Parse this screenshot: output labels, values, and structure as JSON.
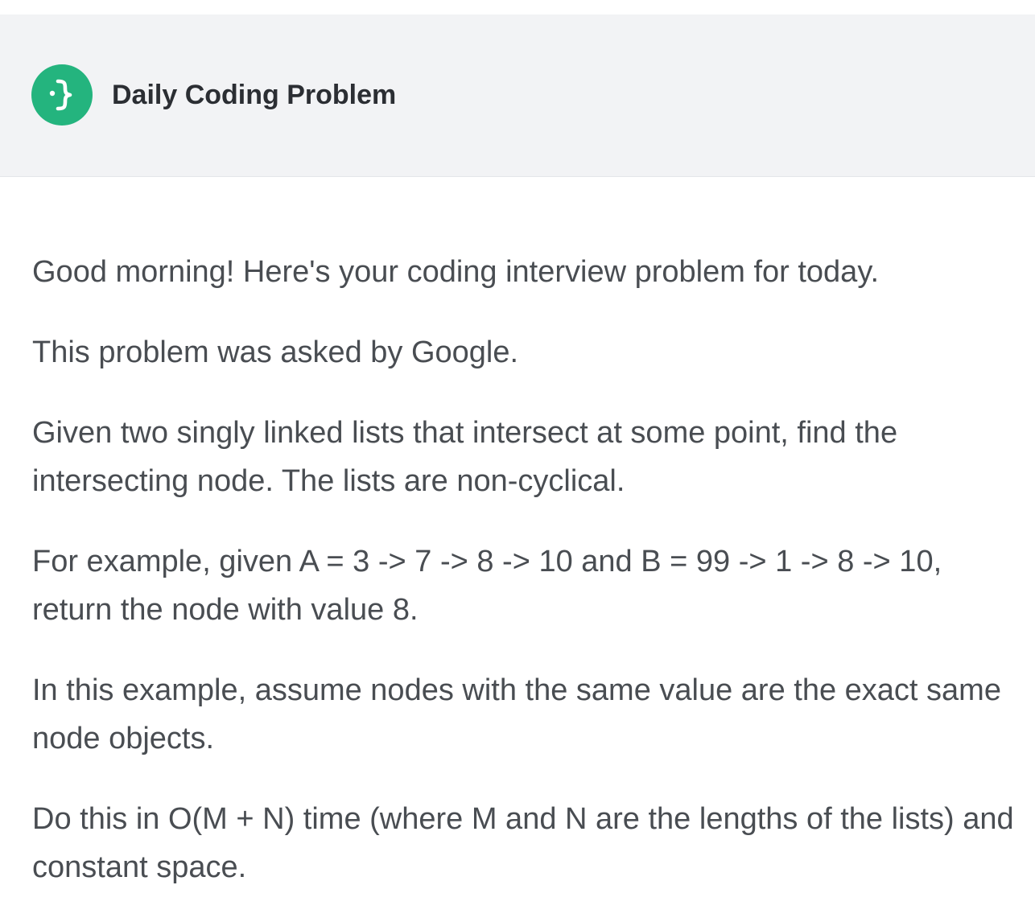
{
  "header": {
    "brand_name": "Daily Coding Problem",
    "logo_icon": "curly-brace-icon",
    "logo_color": "#24b47e",
    "background_color": "#f2f3f5"
  },
  "email": {
    "greeting": "Good morning! Here's your coding interview problem for today.",
    "asked_by": "This problem was asked by Google.",
    "paragraphs": [
      "Given two singly linked lists that intersect at some point, find the intersecting node. The lists are non-cyclical.",
      "For example, given A = 3 -> 7 -> 8 -> 10 and B = 99 -> 1 -> 8 -> 10, return the node with value 8.",
      "In this example, assume nodes with the same value are the exact same node objects.",
      "Do this in O(M + N) time (where M and N are the lengths of the lists) and constant space."
    ],
    "text_color": "#494d52"
  }
}
